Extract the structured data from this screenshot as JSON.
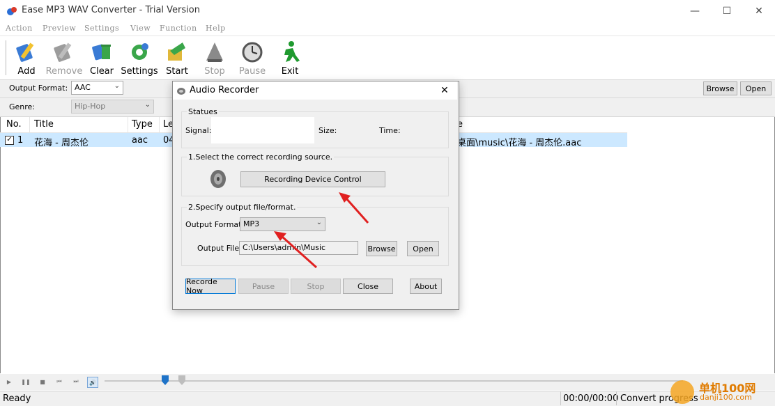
{
  "window": {
    "title": "Ease MP3 WAV Converter - Trial Version"
  },
  "menu": [
    "Action",
    "Preview",
    "Settings",
    "View",
    "Function",
    "Help"
  ],
  "toolbar": {
    "add": "Add",
    "remove": "Remove",
    "clear": "Clear",
    "settings": "Settings",
    "start": "Start",
    "stop": "Stop",
    "pause": "Pause",
    "exit": "Exit"
  },
  "options": {
    "output_format_label": "Output Format:",
    "output_format_value": "AAC",
    "genre_label": "Genre:",
    "genre_value": "Hip-Hop",
    "browse": "Browse",
    "open": "Open"
  },
  "list": {
    "headers": {
      "no": "No.",
      "title": "Title",
      "type": "Type",
      "length": "Le",
      "path": "e"
    },
    "rows": [
      {
        "no": "1",
        "title": "花海 - 周杰伦",
        "type": "aac",
        "length": "04",
        "path": "桌面\\music\\花海 - 周杰伦.aac"
      }
    ]
  },
  "dialog": {
    "title": "Audio Recorder",
    "statues_label": "Statues",
    "signal_label": "Signal:",
    "size_label": "Size:",
    "time_label": "Time:",
    "step1_label": "1.Select the correct recording source.",
    "device_control": "Recording Device Control",
    "step2_label": "2.Specify output file/format.",
    "output_format_label": "Output Format:",
    "output_format_value": "MP3",
    "output_file_label": "Output File:",
    "output_file_value": "C:\\Users\\admin\\Music",
    "browse": "Browse",
    "open": "Open",
    "record_now": "Recorde Now",
    "pause": "Pause",
    "stop": "Stop",
    "close": "Close",
    "about": "About"
  },
  "status": {
    "ready": "Ready",
    "time": "00:00/00:00",
    "convert": "Convert progress"
  },
  "watermark": {
    "text": "单机100网",
    "url": "danji100.com"
  },
  "colors": {
    "selection": "#cce8ff",
    "arrow": "#e02020",
    "slider_thumb": "#1e73c8"
  }
}
